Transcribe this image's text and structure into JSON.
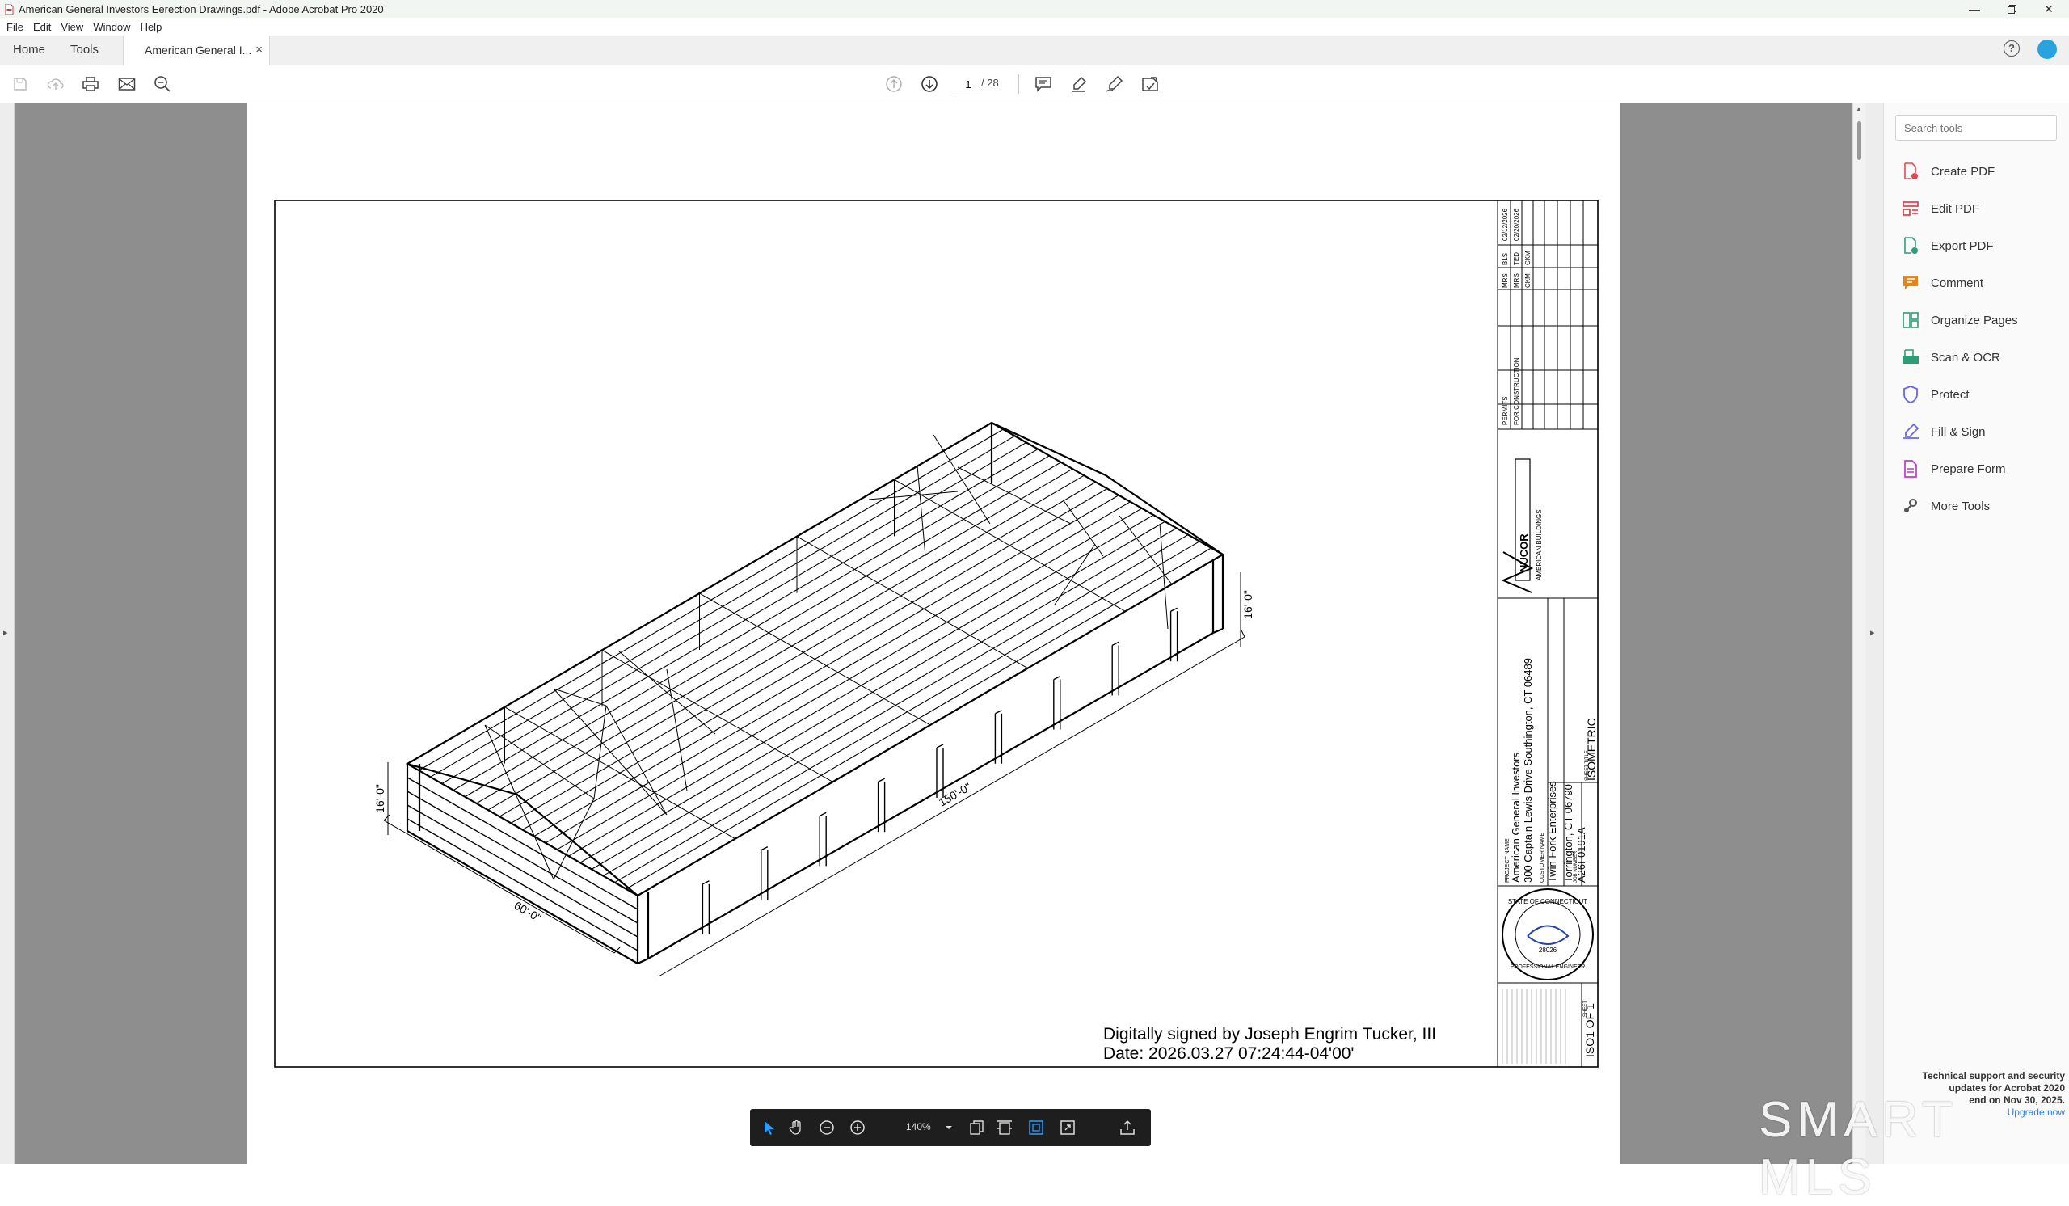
{
  "window": {
    "title": "American General Investors  Eerection Drawings.pdf - Adobe Acrobat Pro 2020",
    "controls": [
      "minimize-icon",
      "restore-icon",
      "close-icon"
    ]
  },
  "menu": [
    "File",
    "Edit",
    "View",
    "Window",
    "Help"
  ],
  "tabs": {
    "home": "Home",
    "tools": "Tools",
    "document": "American General I...",
    "close_glyph": "×"
  },
  "toolbar": {
    "icons": [
      "save-icon",
      "upload-icon",
      "print-icon",
      "email-icon",
      "zoom-out-search-icon",
      "prev-page-icon",
      "next-page-icon",
      "comment-icon",
      "highlight-icon",
      "sign-icon",
      "stamp-icon"
    ],
    "page_current": "1",
    "page_total": "/ 28"
  },
  "tools_pane": {
    "search_placeholder": "Search tools",
    "items": [
      {
        "label": "Create PDF",
        "icon": "create-pdf-icon",
        "color": "#e34850"
      },
      {
        "label": "Edit PDF",
        "icon": "edit-pdf-icon",
        "color": "#d7373f"
      },
      {
        "label": "Export PDF",
        "icon": "export-pdf-icon",
        "color": "#2d9d78"
      },
      {
        "label": "Comment",
        "icon": "comment-icon",
        "color": "#e68619"
      },
      {
        "label": "Organize Pages",
        "icon": "organize-pages-icon",
        "color": "#2d9d78"
      },
      {
        "label": "Scan & OCR",
        "icon": "scan-ocr-icon",
        "color": "#2d9d78"
      },
      {
        "label": "Protect",
        "icon": "protect-icon",
        "color": "#6767ec"
      },
      {
        "label": "Fill & Sign",
        "icon": "fill-sign-icon",
        "color": "#6767ec"
      },
      {
        "label": "Prepare Form",
        "icon": "prepare-form-icon",
        "color": "#c038cc"
      },
      {
        "label": "More Tools",
        "icon": "more-tools-icon",
        "color": "#555555"
      }
    ],
    "notice": {
      "heading": "Technical support and security",
      "line2": "updates for Acrobat 2020",
      "line3": "end on Nov 30, 2025.",
      "link": "Upgrade now"
    }
  },
  "floating_toolbar": {
    "zoom": "140%",
    "icons": [
      "select-arrow-icon",
      "hand-icon",
      "zoom-out-icon",
      "zoom-in-icon",
      "zoom-dropdown-icon",
      "page-view-icon",
      "fit-width-icon",
      "fit-page-icon",
      "full-screen-icon",
      "share-icon"
    ]
  },
  "drawing": {
    "dimensions": {
      "length": "150'-0\"",
      "width": "60'-0\"",
      "eave_left": "16'-0\"",
      "eave_right": "16'-0\""
    },
    "signature": {
      "line1": "Digitally signed by Joseph Engrim Tucker, III",
      "line2": "Date: 2026.03.27 07:24:44-04'00'"
    },
    "title_block": {
      "project_name_label": "PROJECT NAME",
      "project_name": "American General Investors",
      "project_address": "300 Captain Lewis Drive Southington, CT 06489",
      "customer_label": "CUSTOMER NAME",
      "customer": "Twin Fork Enterprises",
      "customer_city": "Torrington, CT 06790",
      "job_label": "JOB NUMBER",
      "job": "A26F0191A",
      "sheet_title_label": "SHEET TITLE",
      "sheet_title": "ISOMETRIC",
      "sheet_label": "SHEET",
      "sheet": "ISO1 OF 1",
      "company": "NUCOR",
      "company_sub": "AMERICAN BUILDINGS",
      "seal_top": "STATE OF CONNECTICUT",
      "seal_bottom": "PROFESSIONAL ENGINEER",
      "seal_license": "28026",
      "rev_rows": [
        {
          "date": "02/12/2026",
          "by": "MRS",
          "chk": "BLS",
          "app": "CKM",
          "desc": "PERMITS"
        },
        {
          "date": "02/20/2026",
          "by": "MRS",
          "chk": "TED",
          "app": "CKM",
          "desc": "FOR CONSTRUCTION"
        }
      ]
    }
  },
  "watermark": "SMART MLS"
}
